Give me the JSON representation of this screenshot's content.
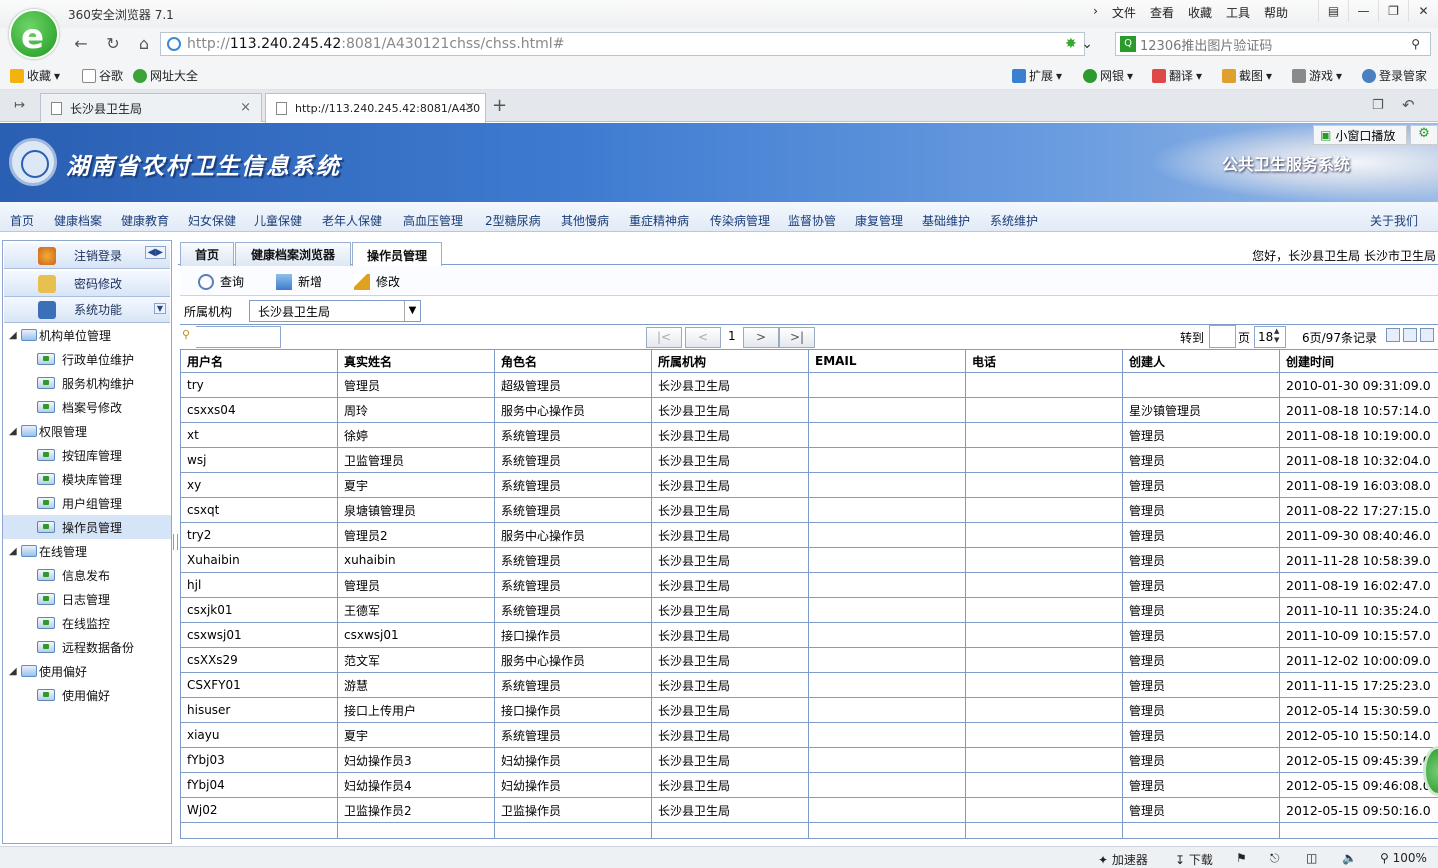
{
  "browser": {
    "app_title": "360安全浏览器 7.1",
    "logo_glyph": "e",
    "menu": [
      "文件",
      "查看",
      "收藏",
      "工具",
      "帮助"
    ],
    "nav_prev_glyph": "›",
    "address_prefix": "http://",
    "address_host": "113.240.245.42",
    "address_rest": ":8081/A430121chss/chss.html#",
    "search_placeholder": "12306推出图片验证码",
    "search_badge": "Q",
    "bookmarks": {
      "fav": "收藏",
      "google": "谷歌",
      "sites": "网址大全",
      "ext": "扩展",
      "bank": "网银",
      "translate": "翻译",
      "screenshot": "截图",
      "games": "游戏",
      "login": "登录管家"
    },
    "tabs": [
      {
        "label": "长沙县卫生局"
      },
      {
        "label": "http://113.240.245.42:8081/A430"
      }
    ],
    "new_tab_glyph": "+",
    "mini_play": "小窗口播放",
    "status": {
      "accel": "加速器",
      "download": "下载",
      "zoom": "100%"
    }
  },
  "header": {
    "system_title": "湖南省农村卫生信息系统",
    "subtitle": "公共卫生服务系统"
  },
  "main_nav": [
    "首页",
    "健康档案",
    "健康教育",
    "妇女保健",
    "儿童保健",
    "老年人保健",
    "高血压管理",
    "2型糖尿病",
    "其他慢病",
    "重症精神病",
    "传染病管理",
    "监督协管",
    "康复管理",
    "基础维护",
    "系统维护"
  ],
  "about": "关于我们",
  "left_panel": {
    "logout": "注销登录",
    "change_password": "密码修改",
    "system_functions": "系统功能",
    "tree": [
      {
        "label": "机构单位管理",
        "children": [
          "行政单位维护",
          "服务机构维护",
          "档案号修改"
        ]
      },
      {
        "label": "权限管理",
        "children": [
          "按钮库管理",
          "模块库管理",
          "用户组管理",
          "操作员管理"
        ]
      },
      {
        "label": "在线管理",
        "children": [
          "信息发布",
          "日志管理",
          "在线监控",
          "远程数据备份"
        ]
      },
      {
        "label": "使用偏好",
        "children": [
          "使用偏好"
        ]
      }
    ],
    "selected": "操作员管理"
  },
  "content": {
    "tabs": [
      "首页",
      "健康档案浏览器",
      "操作员管理"
    ],
    "greeting": "您好，长沙县卫生局  长沙市卫生局",
    "toolbar": {
      "query": "查询",
      "add": "新增",
      "edit": "修改"
    },
    "filter_label": "所属机构",
    "filter_value": "长沙县卫生局",
    "pager": {
      "first": "|<",
      "prev": "<",
      "current": "1",
      "next": ">",
      "last": ">|",
      "goto": "转到",
      "page_word": "页",
      "page_size": "18",
      "total": "6页/97条记录"
    },
    "columns": [
      "用户名",
      "真实姓名",
      "角色名",
      "所属机构",
      "EMAIL",
      "电话",
      "创建人",
      "创建时间"
    ],
    "rows": [
      [
        "try",
        "管理员",
        "超级管理员",
        "长沙县卫生局",
        "",
        "",
        "",
        "2010-01-30 09:31:09.0"
      ],
      [
        "csxxs04",
        "周玲",
        "服务中心操作员",
        "长沙县卫生局",
        "",
        "",
        "星沙镇管理员",
        "2011-08-18 10:57:14.0"
      ],
      [
        "xt",
        "徐婷",
        "系统管理员",
        "长沙县卫生局",
        "",
        "",
        "管理员",
        "2011-08-18 10:19:00.0"
      ],
      [
        "wsj",
        "卫监管理员",
        "系统管理员",
        "长沙县卫生局",
        "",
        "",
        "管理员",
        "2011-08-18 10:32:04.0"
      ],
      [
        "xy",
        "夏宇",
        "系统管理员",
        "长沙县卫生局",
        "",
        "",
        "管理员",
        "2011-08-19 16:03:08.0"
      ],
      [
        "csxqt",
        "泉塘镇管理员",
        "系统管理员",
        "长沙县卫生局",
        "",
        "",
        "管理员",
        "2011-08-22 17:27:15.0"
      ],
      [
        "try2",
        "管理员2",
        "服务中心操作员",
        "长沙县卫生局",
        "",
        "",
        "管理员",
        "2011-09-30 08:40:46.0"
      ],
      [
        "Xuhaibin",
        "xuhaibin",
        "系统管理员",
        "长沙县卫生局",
        "",
        "",
        "管理员",
        "2011-11-28 10:58:39.0"
      ],
      [
        "hjl",
        "管理员",
        "系统管理员",
        "长沙县卫生局",
        "",
        "",
        "管理员",
        "2011-08-19 16:02:47.0"
      ],
      [
        "csxjk01",
        "王德军",
        "系统管理员",
        "长沙县卫生局",
        "",
        "",
        "管理员",
        "2011-10-11 10:35:24.0"
      ],
      [
        "csxwsj01",
        "csxwsj01",
        "接口操作员",
        "长沙县卫生局",
        "",
        "",
        "管理员",
        "2011-10-09 10:15:57.0"
      ],
      [
        "csXXs29",
        "范文军",
        "服务中心操作员",
        "长沙县卫生局",
        "",
        "",
        "管理员",
        "2011-12-02 10:00:09.0"
      ],
      [
        "CSXFY01",
        "游慧",
        "系统管理员",
        "长沙县卫生局",
        "",
        "",
        "管理员",
        "2011-11-15 17:25:23.0"
      ],
      [
        "hisuser",
        "接口上传用户",
        "接口操作员",
        "长沙县卫生局",
        "",
        "",
        "管理员",
        "2012-05-14 15:30:59.0"
      ],
      [
        "xiayu",
        "夏宇",
        "系统管理员",
        "长沙县卫生局",
        "",
        "",
        "管理员",
        "2012-05-10 15:50:14.0"
      ],
      [
        "fYbj03",
        "妇幼操作员3",
        "妇幼操作员",
        "长沙县卫生局",
        "",
        "",
        "管理员",
        "2012-05-15 09:45:39.0"
      ],
      [
        "fYbj04",
        "妇幼操作员4",
        "妇幼操作员",
        "长沙县卫生局",
        "",
        "",
        "管理员",
        "2012-05-15 09:46:08.0"
      ],
      [
        "Wj02",
        "卫监操作员2",
        "卫监操作员",
        "长沙县卫生局",
        "",
        "",
        "管理员",
        "2012-05-15 09:50:16.0"
      ]
    ]
  },
  "colors": {
    "nav_text": "#1a3d7a",
    "grid_border": "#7f9cc8",
    "banner": "#2a5fb3"
  }
}
